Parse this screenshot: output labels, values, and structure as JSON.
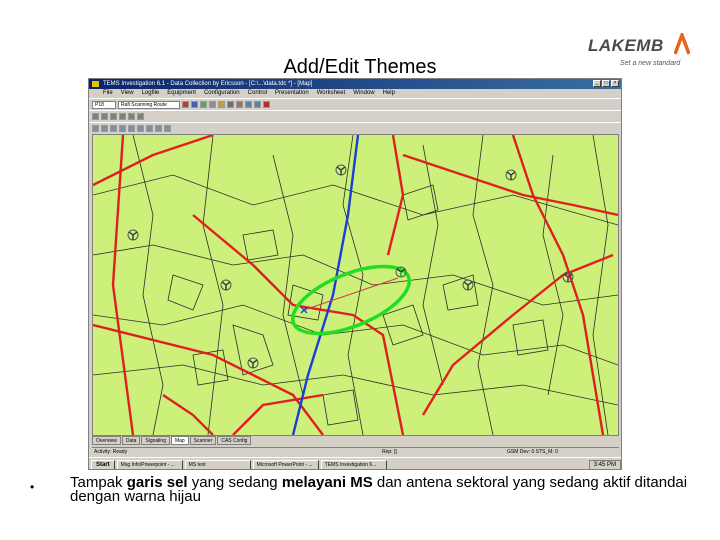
{
  "slide": {
    "title": "Add/Edit Themes",
    "logo_text": "LAKEMB",
    "logo_tagline": "Set a new standard",
    "bullet": {
      "part1": "Tampak ",
      "bold1": "garis sel",
      "part2": " yang sedang ",
      "bold2": "melayani MS",
      "part3": " dan antena sektoral yang sedang aktif ditandai dengan warna hijau"
    }
  },
  "app": {
    "title": "TEMS Investigation 6.1 - Data Collection by Ericsson - [C:\\...\\data.tdc *] - [Map]",
    "menu": [
      "File",
      "View",
      "Logfile",
      "Equipment",
      "Configuration",
      "Control",
      "Presentation",
      "Worksheet",
      "Window",
      "Help"
    ],
    "toolbar_select1": "P18",
    "toolbar_select2": "Rafi Scanning Route",
    "tabs": [
      "Overview",
      "Data",
      "Signaling",
      "Map",
      "Scanner",
      "CAS Config"
    ],
    "active_tab": "Map",
    "status_left": "Activity: Ready",
    "status_mid": "Rep: []",
    "status_right": "GSM Dev: 0   STS_M: 0",
    "taskbar": {
      "start": "Start",
      "items": [
        "Msg Info/Powerpoint - ...",
        "MS test",
        "Microsoft PowerPoint - ...",
        "TEMS Investigation 6..."
      ],
      "clock": "3:45 PM"
    }
  },
  "colors": {
    "map_background": "#ccf07a",
    "major_road": "#e02020",
    "rail_line": "#1a3fd6",
    "minor_road": "#2c2c2c",
    "highlight": "#22dd22",
    "cell_line": "#d04040"
  }
}
